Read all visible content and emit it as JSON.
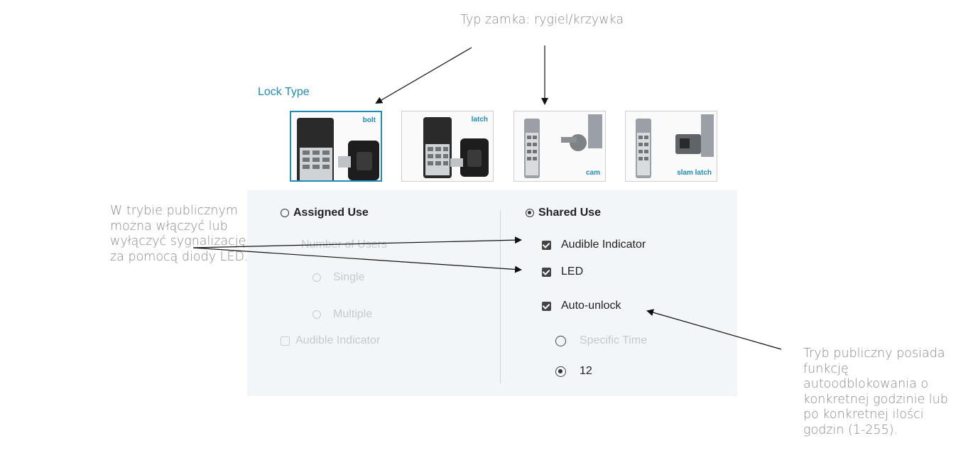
{
  "annotations": {
    "top": "Typ zamka: rygiel/krzywka",
    "left": "W trybie publicznym\nmożna włączyć lub\nwyłączyć sygnalizację\nza pomocą diody LED.",
    "right": "Tryb publiczny posiada\nfunkcję\nautoodblokowania o\nkonkretnej godzinie lub\npo konkretnej ilości\ngodzin (1-255)."
  },
  "lock_type": {
    "title": "Lock Type",
    "options": [
      {
        "label": "bolt",
        "selected": true
      },
      {
        "label": "latch",
        "selected": false
      },
      {
        "label": "cam",
        "selected": false
      },
      {
        "label": "slam latch",
        "selected": false
      }
    ]
  },
  "assigned": {
    "label": "Assigned Use",
    "selected": false,
    "number_of_users": "Number of Users",
    "single": "Single",
    "multiple": "Multiple",
    "audible": "Audible Indicator"
  },
  "shared": {
    "label": "Shared Use",
    "selected": true,
    "audible": "Audible Indicator",
    "audible_checked": true,
    "led": "LED",
    "led_checked": true,
    "auto_unlock": "Auto-unlock",
    "auto_unlock_checked": true,
    "specific_time": "Specific Time",
    "hours_value": "12"
  },
  "colors": {
    "accent": "#1e8cb4",
    "panel": "#f3f6f8"
  }
}
